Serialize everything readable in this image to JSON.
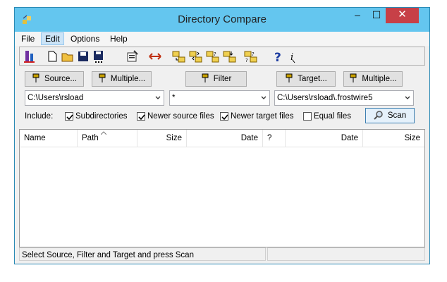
{
  "window": {
    "title": "Directory Compare",
    "minimize": "–",
    "maximize": "☐",
    "close": "✕"
  },
  "menu": [
    "File",
    "Edit",
    "Options",
    "Help"
  ],
  "buttons": {
    "source": "Source...",
    "multiple_left": "Multiple...",
    "filter": "Filter",
    "target": "Target...",
    "multiple_right": "Multiple...",
    "scan": "Scan"
  },
  "paths": {
    "source": "C:\\Users\\rsload",
    "filter": "*",
    "target": "C:\\Users\\rsload\\.frostwire5"
  },
  "include": {
    "label": "Include:",
    "options": [
      {
        "label": "Subdirectories",
        "checked": true
      },
      {
        "label": "Newer source files",
        "checked": true
      },
      {
        "label": "Newer target files",
        "checked": true
      },
      {
        "label": "Equal files",
        "checked": false
      }
    ]
  },
  "columns": [
    "Name",
    "Path",
    "Size",
    "Date",
    "?",
    "Date",
    "Size"
  ],
  "status": "Select Source, Filter and Target and press Scan",
  "toolbar_icons": [
    "compare-icon",
    "new-icon",
    "open-icon",
    "save-icon",
    "save-as-icon",
    "properties-icon",
    "swap-icon",
    "copy-right-icon",
    "copy-both-icon",
    "copy-mixed-icon",
    "move-icon",
    "compare-files-icon",
    "help-icon",
    "context-help-icon"
  ]
}
